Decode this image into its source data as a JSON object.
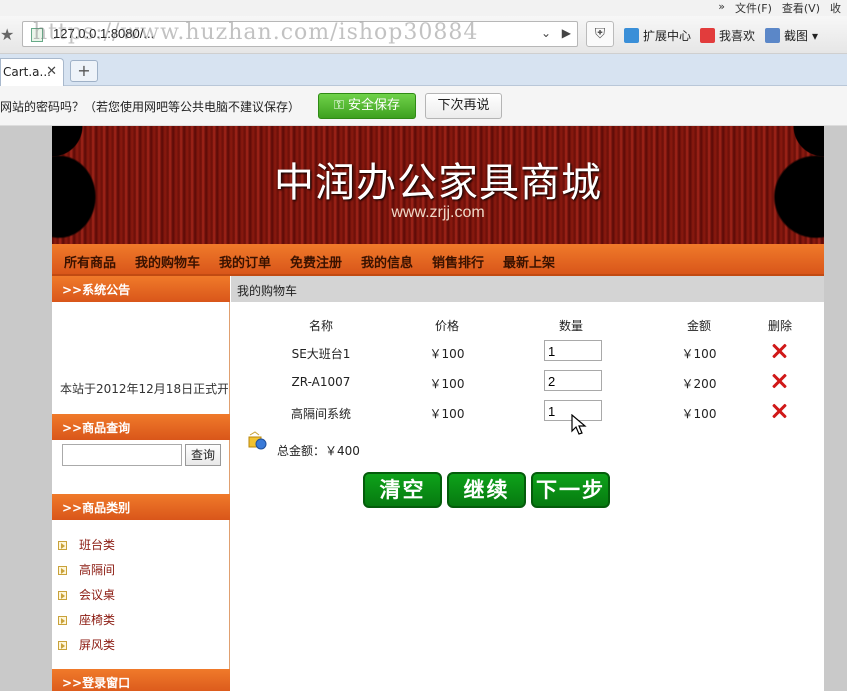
{
  "browser": {
    "menu": [
      "文件(F)",
      "查看(V)",
      "收"
    ],
    "url": "127.0.0.1:8080/...",
    "watermark": "https://www.huzhan.com/ishop30884",
    "extensions": [
      "扩展中心",
      "我喜欢",
      "截图"
    ],
    "tab_title": "Cart.a...",
    "password_prompt": "网站的密码吗？（若您使用网吧等公共电脑不建议保存）",
    "save_button": "安全保存",
    "later_button": "下次再说"
  },
  "site": {
    "title": "中润办公家具商城",
    "domain": "www.zrjj.com",
    "nav": [
      "所有商品",
      "我的购物车",
      "我的订单",
      "免费注册",
      "我的信息",
      "销售排行",
      "最新上架"
    ]
  },
  "sidebar": {
    "notice_header": ">>系统公告",
    "notice_text": "本站于2012年12月18日正式开",
    "search_header": ">>商品查询",
    "search_button": "查询",
    "category_header": ">>商品类别",
    "categories": [
      "班台类",
      "高隔间",
      "会议桌",
      "座椅类",
      "屏风类"
    ],
    "login_header": ">>登录窗口"
  },
  "cart": {
    "breadcrumb": "我的购物车",
    "headers": [
      "名称",
      "价格",
      "数量",
      "金额",
      "删除"
    ],
    "rows": [
      {
        "name": "SE大班台1",
        "price": "￥100",
        "qty": "1",
        "amount": "￥100"
      },
      {
        "name": "ZR-A1007",
        "price": "￥100",
        "qty": "2",
        "amount": "￥200"
      },
      {
        "name": "高隔间系统",
        "price": "￥100",
        "qty": "1",
        "amount": "￥100"
      }
    ],
    "total": "总金额：￥400",
    "buttons": [
      "清空",
      "继续",
      "下一步"
    ]
  }
}
